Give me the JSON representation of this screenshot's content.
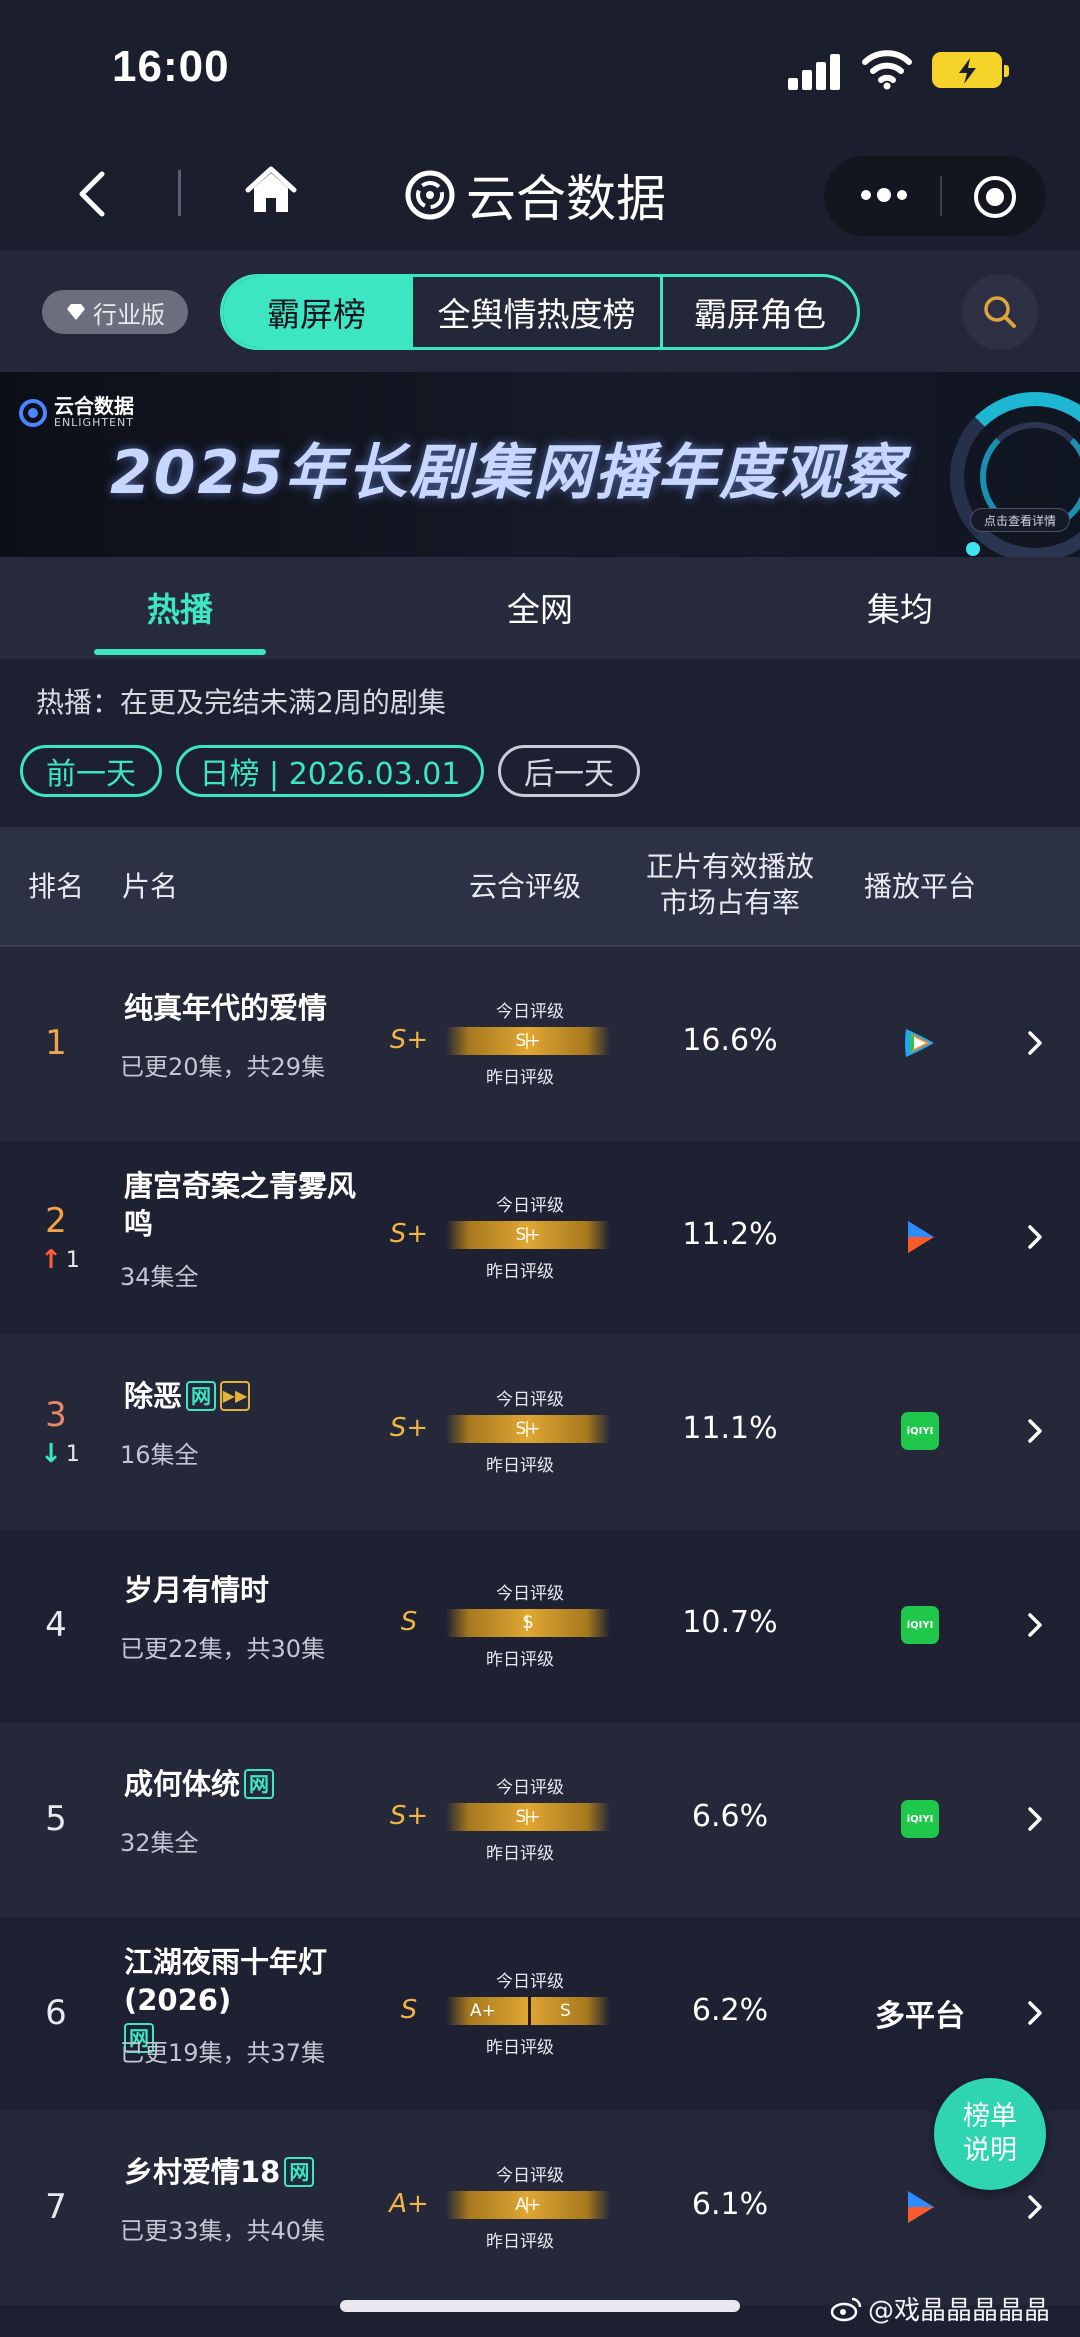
{
  "status": {
    "time": "16:00"
  },
  "header": {
    "app_title": "云合数据",
    "icons": [
      "back-icon",
      "home-icon",
      "more-icon",
      "target-icon"
    ]
  },
  "filter": {
    "edition": "行业版",
    "segments": [
      "霸屏榜",
      "全舆情热度榜",
      "霸屏角色"
    ],
    "active_segment": "霸屏榜"
  },
  "banner": {
    "logo_main": "云合数据",
    "logo_sub": "ENLIGHTENT",
    "title": "2025年长剧集网播年度观察",
    "cta": "点击查看详情"
  },
  "tabs": {
    "items": [
      "热播",
      "全网",
      "集均"
    ],
    "active": "热播"
  },
  "info": {
    "description": "热播：在更及完结未满2周的剧集",
    "prev_day": "前一天",
    "date_label": "日榜 | 2026.03.01",
    "next_day": "后一天"
  },
  "table": {
    "headers": {
      "rank": "排名",
      "title": "片名",
      "grade": "云合评级",
      "share_line1": "正片有效播放",
      "share_line2": "市场占有率",
      "platform": "播放平台"
    },
    "today_label": "今日评级",
    "yesterday_label": "昨日评级",
    "rows": [
      {
        "rank": "1",
        "change_dir": "",
        "change_val": "",
        "title": "纯真年代的爱情",
        "badges": [],
        "episodes": "已更20集，共29集",
        "grade": "S+",
        "grade_today": "S+",
        "grade_yesterday": "",
        "share": "16.6%",
        "platform_icon": "tencent-video-icon",
        "platform_text": ""
      },
      {
        "rank": "2",
        "change_dir": "up",
        "change_val": "1",
        "title": "唐宫奇案之青雾风鸣",
        "badges": [],
        "episodes": "34集全",
        "grade": "S+",
        "grade_today": "S+",
        "grade_yesterday": "",
        "share": "11.2%",
        "platform_icon": "youku-icon",
        "platform_text": ""
      },
      {
        "rank": "3",
        "change_dir": "down",
        "change_val": "1",
        "title": "除恶",
        "badges": [
          "网",
          "play"
        ],
        "episodes": "16集全",
        "grade": "S+",
        "grade_today": "S+",
        "grade_yesterday": "",
        "share": "11.1%",
        "platform_icon": "iqiyi-icon",
        "platform_text": "iQIYI"
      },
      {
        "rank": "4",
        "change_dir": "",
        "change_val": "",
        "title": "岁月有情时",
        "badges": [],
        "episodes": "已更22集，共30集",
        "grade": "S",
        "grade_today": "S",
        "grade_yesterday": "",
        "share": "10.7%",
        "platform_icon": "iqiyi-icon",
        "platform_text": "iQIYI"
      },
      {
        "rank": "5",
        "change_dir": "",
        "change_val": "",
        "title": "成何体统",
        "badges": [
          "网"
        ],
        "episodes": "32集全",
        "grade": "S+",
        "grade_today": "S+",
        "grade_yesterday": "",
        "share": "6.6%",
        "platform_icon": "iqiyi-icon",
        "platform_text": "iQIYI"
      },
      {
        "rank": "6",
        "change_dir": "",
        "change_val": "",
        "title": "江湖夜雨十年灯(2026)",
        "badges": [
          "网"
        ],
        "episodes": "已更19集，共37集",
        "grade": "S",
        "grade_today": "S",
        "grade_yesterday": "A+",
        "share": "6.2%",
        "platform_icon": "",
        "platform_text": "多平台"
      },
      {
        "rank": "7",
        "change_dir": "",
        "change_val": "",
        "title": "乡村爱情18",
        "badges": [
          "网"
        ],
        "episodes": "已更33集，共40集",
        "grade": "A+",
        "grade_today": "A+",
        "grade_yesterday": "",
        "share": "6.1%",
        "platform_icon": "youku-icon",
        "platform_text": ""
      }
    ]
  },
  "float_button": {
    "line1": "榜单",
    "line2": "说明"
  },
  "watermark": "@戏晶晶晶晶晶",
  "colors": {
    "accent": "#3de6c2",
    "gold": "#f0b544",
    "background": "#1d2030"
  }
}
